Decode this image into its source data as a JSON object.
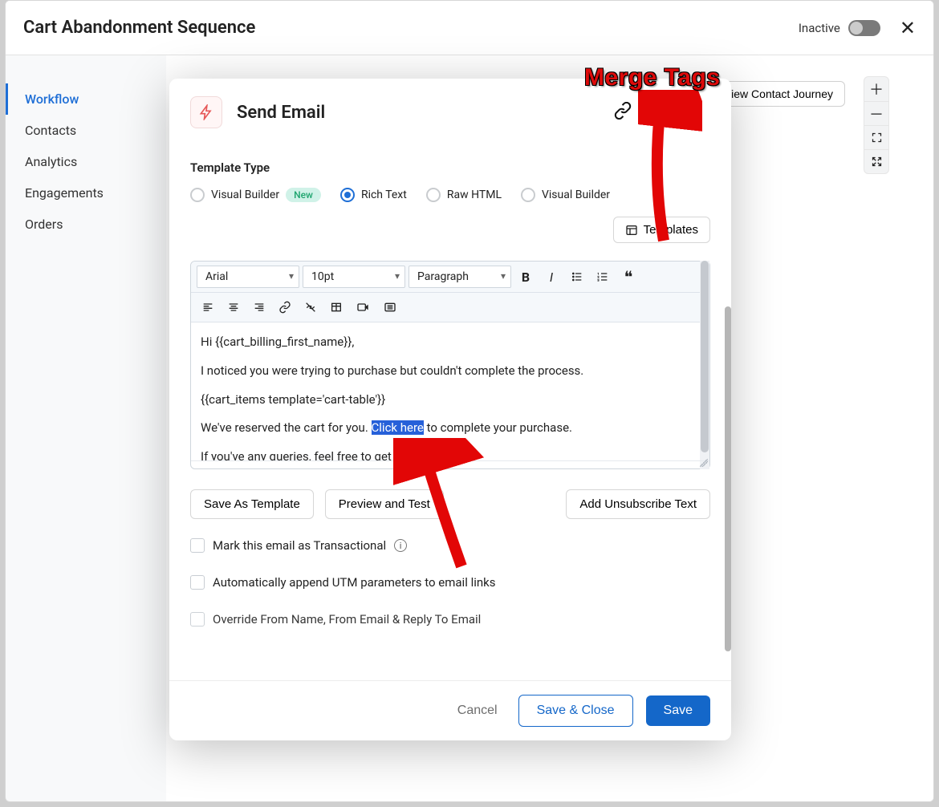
{
  "header": {
    "title": "Cart Abandonment Sequence",
    "status": "Inactive"
  },
  "sidebar": {
    "items": [
      "Workflow",
      "Contacts",
      "Analytics",
      "Engagements",
      "Orders"
    ],
    "activeIndex": 0
  },
  "canvas": {
    "journeyButton": "View Contact Journey"
  },
  "modal": {
    "title": "Send Email",
    "templateTypeLabel": "Template Type",
    "options": {
      "visualBuilderNew": "Visual Builder",
      "newBadge": "New",
      "richText": "Rich Text",
      "rawHtml": "Raw HTML",
      "visualBuilder": "Visual Builder"
    },
    "templatesButton": "Templates",
    "editor": {
      "font": "Arial",
      "size": "10pt",
      "block": "Paragraph",
      "lines": {
        "greeting": "Hi {{cart_billing_first_name}},",
        "line2": "I noticed you were trying to purchase but couldn't complete the process.",
        "line3": "{{cart_items template='cart-table'}}",
        "line4a": "We've reserved the cart for you. ",
        "line4link": "Click here",
        "line4b": " to complete your purchase.",
        "line5": "If you've any queries, feel free to get in to     h with us."
      }
    },
    "buttons": {
      "saveTemplate": "Save As Template",
      "previewTest": "Preview and Test",
      "addUnsub": "Add Unsubscribe Text"
    },
    "checks": {
      "transactional": "Mark this email as Transactional",
      "utm": "Automatically append UTM parameters to email links",
      "override": "Override From Name, From Email & Reply To Email"
    },
    "footer": {
      "cancel": "Cancel",
      "saveClose": "Save & Close",
      "save": "Save"
    }
  },
  "annotation": {
    "label": "Merge Tags"
  }
}
